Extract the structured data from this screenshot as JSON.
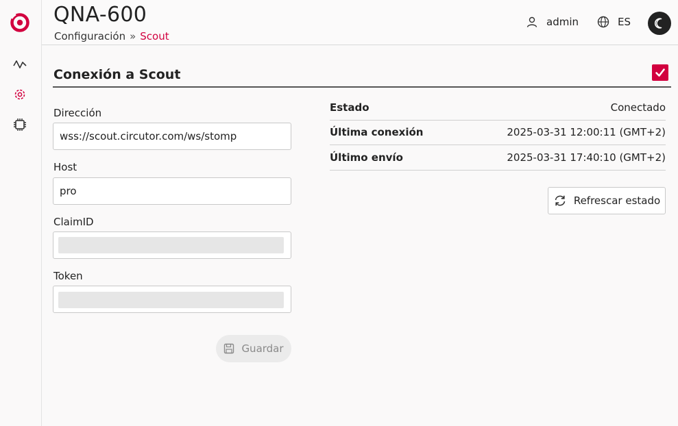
{
  "app": {
    "title": "QNA-600"
  },
  "breadcrumb": {
    "parent": "Configuración",
    "separator": "»",
    "current": "Scout"
  },
  "header": {
    "user": "admin",
    "language": "ES"
  },
  "sidebar": {
    "items": [
      {
        "icon": "activity-icon",
        "active": false
      },
      {
        "icon": "gear-icon",
        "active": true
      },
      {
        "icon": "chip-icon",
        "active": false
      }
    ]
  },
  "section": {
    "title": "Conexión a Scout",
    "enabled": true
  },
  "form": {
    "address": {
      "label": "Dirección",
      "value": "wss://scout.circutor.com/ws/stomp"
    },
    "host": {
      "label": "Host",
      "value": "pro"
    },
    "claim_id": {
      "label": "ClaimID",
      "value": ""
    },
    "token": {
      "label": "Token",
      "value": ""
    },
    "save_label": "Guardar"
  },
  "status": {
    "rows": [
      {
        "key": "Estado",
        "value": "Conectado"
      },
      {
        "key": "Última conexión",
        "value": "2025-03-31 12:00:11 (GMT+2)"
      },
      {
        "key": "Último envío",
        "value": "2025-03-31 17:40:10 (GMT+2)"
      }
    ],
    "refresh_label": "Refrescar estado"
  },
  "colors": {
    "accent": "#d2003f",
    "dark": "#222222",
    "border": "#c8c8c8"
  }
}
